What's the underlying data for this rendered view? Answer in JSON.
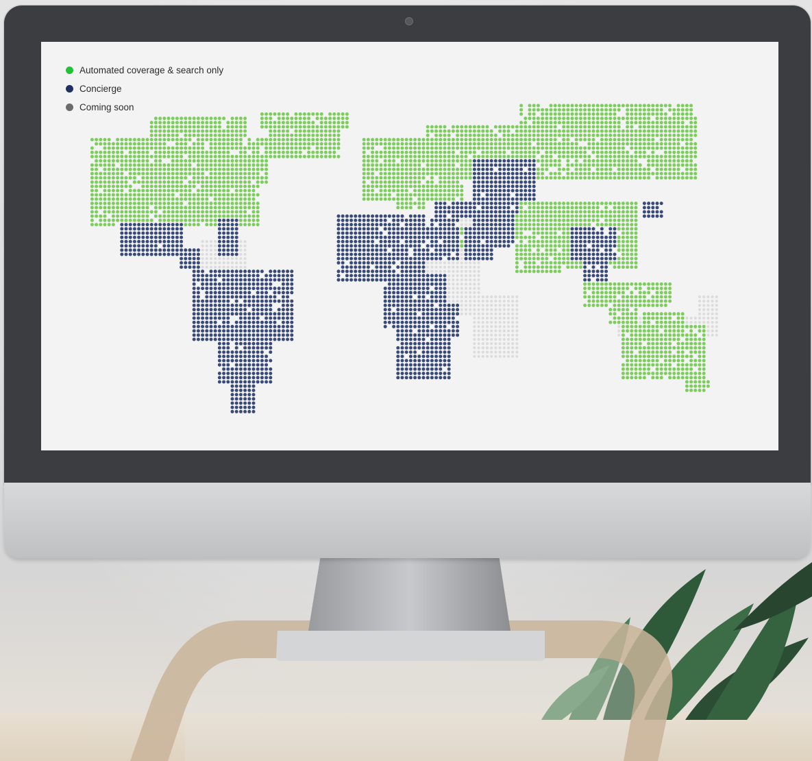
{
  "legend": {
    "items": [
      {
        "label": "Automated coverage & search only",
        "color": "#23c03a"
      },
      {
        "label": "Concierge",
        "color": "#1e3160"
      },
      {
        "label": "Coming soon",
        "color": "#6b6b6b"
      }
    ]
  },
  "map": {
    "colors": {
      "automated": "#7ccd5c",
      "concierge": "#3a4a78",
      "coming_soon": "#dcdcdc"
    }
  }
}
